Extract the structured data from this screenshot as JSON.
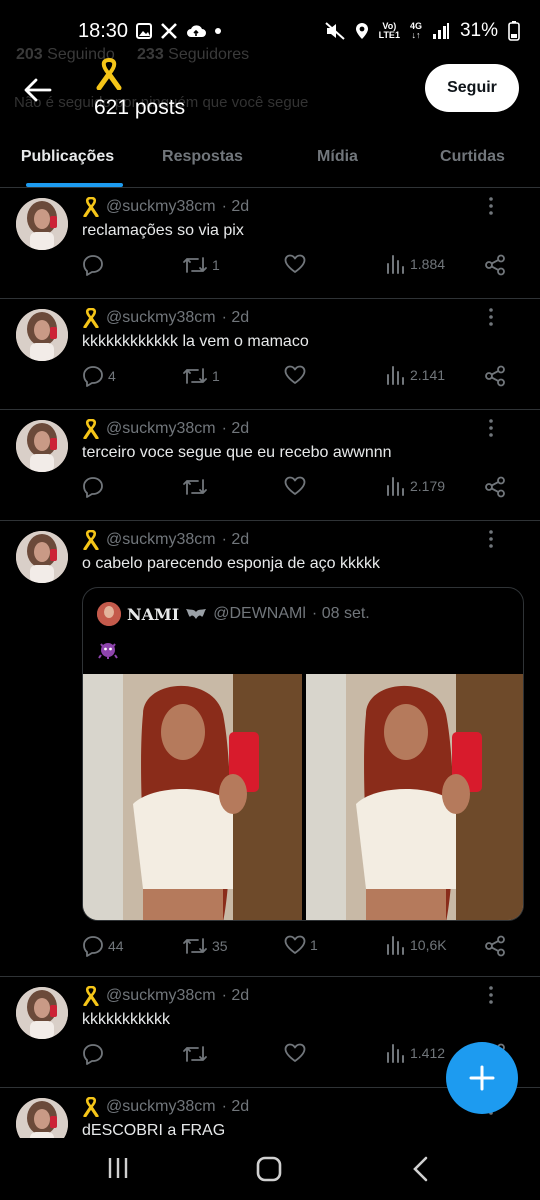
{
  "status_bar": {
    "time": "18:30",
    "network_top": "Vo)",
    "network_bottom": "LTE1",
    "net_type": "4G",
    "battery": "31%"
  },
  "profile_header": {
    "ghost_following": "203",
    "ghost_following_label": "Seguindo",
    "ghost_followers": "233",
    "ghost_followers_label": "Seguidores",
    "ghost_note": "Não é seguido por ninguém que você segue",
    "posts_count": "621 posts",
    "follow_label": "Seguir"
  },
  "tabs": [
    {
      "label": "Publicações",
      "active": true
    },
    {
      "label": "Respostas",
      "active": false
    },
    {
      "label": "Mídia",
      "active": false
    },
    {
      "label": "Curtidas",
      "active": false
    }
  ],
  "tweets": [
    {
      "handle": "@suckmy38cm",
      "time": "· 2d",
      "text": "reclamações so via pix",
      "replies": "",
      "retweets": "1",
      "likes": "",
      "views": "1.884"
    },
    {
      "handle": "@suckmy38cm",
      "time": "· 2d",
      "text": "kkkkkkkkkkkk la vem o mamaco",
      "replies": "4",
      "retweets": "1",
      "likes": "",
      "views": "2.141"
    },
    {
      "handle": "@suckmy38cm",
      "time": "· 2d",
      "text": "terceiro voce segue que eu recebo awwnnn",
      "replies": "",
      "retweets": "",
      "likes": "",
      "views": "2.179"
    },
    {
      "handle": "@suckmy38cm",
      "time": "· 2d",
      "text": "o cabelo  parecendo  esponja  de  aço kkkkk",
      "replies": "44",
      "retweets": "35",
      "likes": "1",
      "views": "10,6K"
    },
    {
      "handle": "@suckmy38cm",
      "time": "· 2d",
      "text": "kkkkkkkkkkk",
      "replies": "",
      "retweets": "",
      "likes": "",
      "views": "1.412"
    },
    {
      "handle": "@suckmy38cm",
      "time": "· 2d",
      "text": "dESCOBRI a FRAG",
      "replies": "",
      "retweets": "",
      "likes": "",
      "views": ""
    }
  ],
  "quote": {
    "name": "NAMI",
    "handle": "@DEWNAMl",
    "time": "· 08 set."
  },
  "colors": {
    "accent": "#1d9bf0",
    "muted": "#71767b",
    "divider": "#2f3336",
    "ribbon": "#f5c518"
  }
}
